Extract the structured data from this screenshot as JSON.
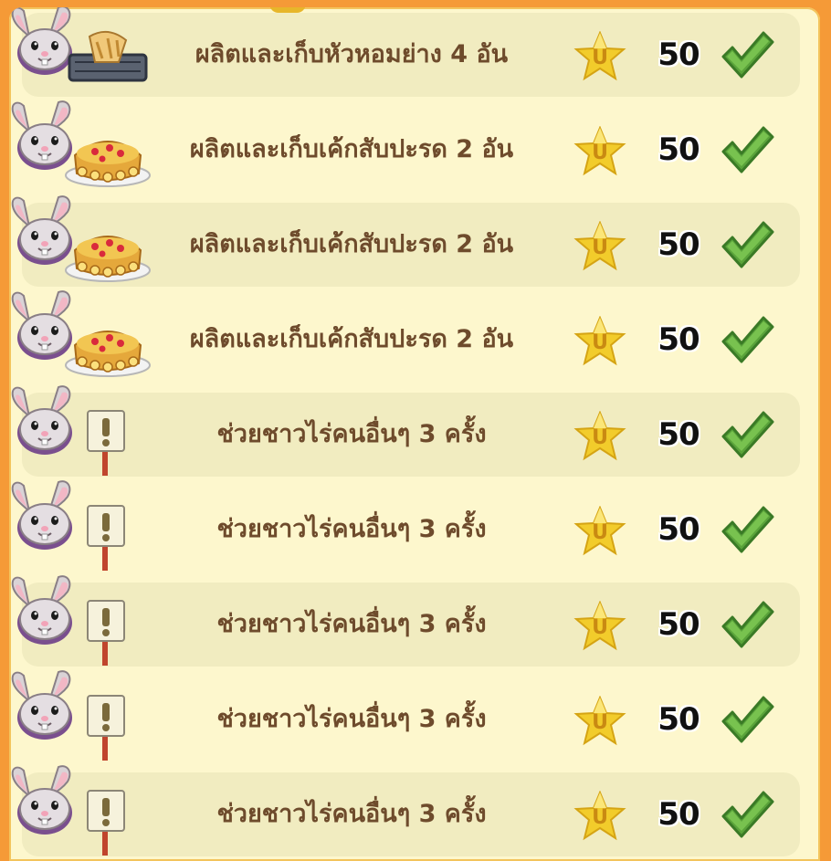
{
  "quest_list": {
    "rows": [
      {
        "text": "ผลิตและเก็บหัวหอมย่าง 4 อัน",
        "item": "roasted-onion-icon",
        "reward": "50",
        "done": true
      },
      {
        "text": "ผลิตและเก็บเค้กสับปะรด 2 อัน",
        "item": "pineapple-cake-icon",
        "reward": "50",
        "done": true
      },
      {
        "text": "ผลิตและเก็บเค้กสับปะรด 2 อัน",
        "item": "pineapple-cake-icon",
        "reward": "50",
        "done": true
      },
      {
        "text": "ผลิตและเก็บเค้กสับปะรด 2 อัน",
        "item": "pineapple-cake-icon",
        "reward": "50",
        "done": true
      },
      {
        "text": "ช่วยชาวไร่คนอื่นๆ 3 ครั้ง",
        "item": "exclamation-sign-icon",
        "reward": "50",
        "done": true
      },
      {
        "text": "ช่วยชาวไร่คนอื่นๆ 3 ครั้ง",
        "item": "exclamation-sign-icon",
        "reward": "50",
        "done": true
      },
      {
        "text": "ช่วยชาวไร่คนอื่นๆ 3 ครั้ง",
        "item": "exclamation-sign-icon",
        "reward": "50",
        "done": true
      },
      {
        "text": "ช่วยชาวไร่คนอื่นๆ 3 ครั้ง",
        "item": "exclamation-sign-icon",
        "reward": "50",
        "done": true
      },
      {
        "text": "ช่วยชาวไร่คนอื่นๆ 3 ครั้ง",
        "item": "exclamation-sign-icon",
        "reward": "50",
        "done": true
      }
    ]
  },
  "colors": {
    "frame": "#f59a37",
    "panel": "#fdf7cd",
    "row_alt": "#f1ecc0",
    "text": "#6e4b2c",
    "check": "#5aa33a",
    "star": "#f2cc2b"
  },
  "icons": {
    "avatar": "bunny-avatar-icon",
    "reward": "experience-star-icon",
    "status": "check-icon"
  }
}
